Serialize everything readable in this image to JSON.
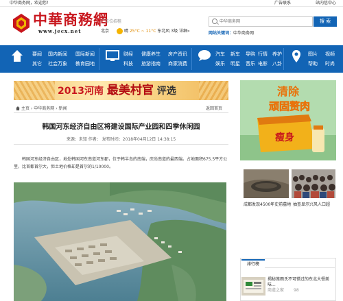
{
  "top_bar": {
    "welcome": "中华商务网，欢迎您！",
    "ad_contact": "广告联系",
    "message_center": "站内信中心"
  },
  "brand": {
    "logo_text": "中華商務網",
    "logo_url": "www.jecx.net",
    "brand_color": "#c8161d"
  },
  "header": {
    "ad_slot": "广告位招租",
    "city": "北京",
    "weather": {
      "condition": "晴",
      "temp": "25°C ~ 11°C",
      "wind": "东北风 3级",
      "extra": "详细»",
      "icon": "sun-icon"
    }
  },
  "search": {
    "placeholder": "中华商务网",
    "button_label": "搜 索",
    "hot_label": "网站关键词：",
    "hot_value": "中华商务网"
  },
  "nav": {
    "bg_color": "#1264b5",
    "groups": [
      {
        "icon": "home-icon",
        "links": [
          "要闻",
          "国内新闻",
          "国际新闻",
          "其它",
          "社会万象",
          "教育园地"
        ]
      },
      {
        "icon": "tv-icon",
        "links": [
          "财经",
          "健康养生",
          "房产资讯",
          "科技",
          "旅游指南",
          "商家消费"
        ]
      },
      {
        "icon": "chat-bubble-icon",
        "links": [
          "汽车",
          "新车",
          "导购",
          "行情",
          "养护",
          "娱乐",
          "明星",
          "音乐",
          "电影",
          "八卦"
        ]
      },
      {
        "icon": "location-pin-icon",
        "links": [
          "图片",
          "视频",
          "帮助",
          "时尚"
        ]
      }
    ]
  },
  "banner": {
    "text_year": "2013河南",
    "text_big": "最美村官",
    "text_tail": "评选"
  },
  "breadcrumb": {
    "items": [
      "主页",
      "中华商务网",
      "新闻"
    ],
    "separator": "›",
    "back_home": "返回首页"
  },
  "article": {
    "title": "韩国河东经济自由区将建设国际产业园和四季休闲园",
    "source_label": "来源：",
    "source": "未知",
    "author_label": "作者：",
    "publish_label": "发布时间：",
    "publish_time": "2018年04月12日 14:38:15",
    "body": "韩国河东经济自由区，地处韩国河东南道河东郡，位于韩半岛的南端，庆尚南道的最西端。占地面积675.5平方公里，比首都首尔大，但土地价格却是首尔的1/10000。"
  },
  "sidebar": {
    "ad_title": "清除",
    "ad_subtitle": "顽固赘肉",
    "ad_product": "瘦身",
    "news": [
      {
        "caption": "成都发现4500年史前墓地"
      },
      {
        "caption": "抽查显示兴风人口超"
      }
    ],
    "rank": {
      "tab_label": "排行榜",
      "title": "揭秘莲雨氏不可错过的东北大餐美味...",
      "source": "商道之家",
      "count": "98"
    }
  }
}
